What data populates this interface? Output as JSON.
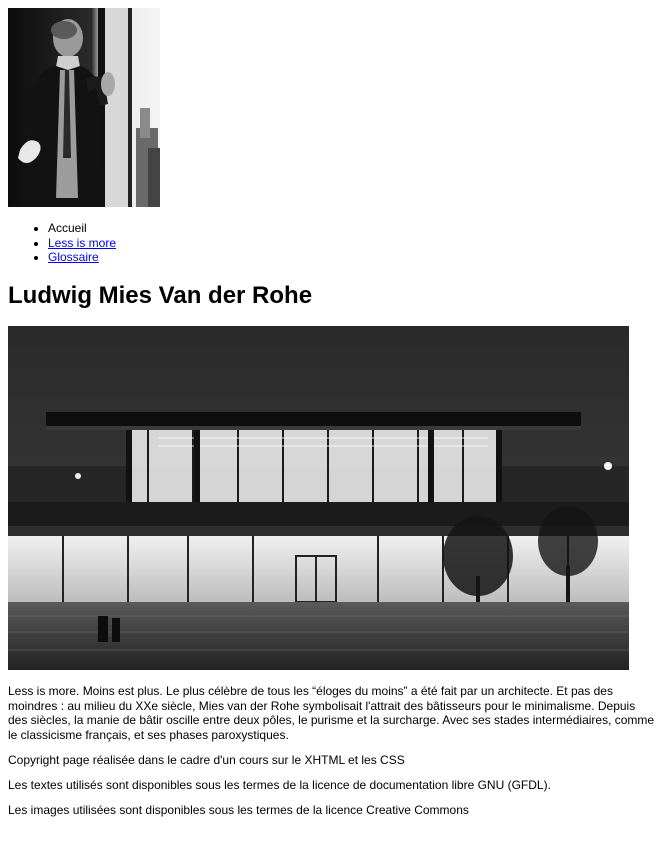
{
  "portrait": {
    "alt": "Ludwig Mies van der Rohe"
  },
  "nav": {
    "items": [
      {
        "label": "Accueil",
        "link": false
      },
      {
        "label": "Less is more",
        "link": true
      },
      {
        "label": "Glossaire",
        "link": true
      }
    ]
  },
  "page_title": "Ludwig Mies Van der Rohe",
  "building": {
    "alt": "Neue Nationalgalerie"
  },
  "content": {
    "intro": "Less is more. Moins est plus. Le plus célèbre de tous les “éloges du moins” a été fait par un architecte. Et pas des moindres : au milieu du XXe siècle, Mies van der Rohe symbolisait l'attrait des bâtisseurs pour le minimalisme. Depuis des siècles, la manie de bâtir oscille entre deux pôles, le purisme et la surcharge. Avec ses stades intermédiaires, comme le classicisme français, et ses phases paroxystiques.",
    "copyright": "Copyright page réalisée dans le cadre d'un cours sur le XHTML et les CSS",
    "gfdl": "Les textes utilisés sont disponibles sous les termes de la licence de documentation libre GNU (GFDL).",
    "cc": "Les images utilisées sont disponibles sous les termes de la licence Creative Commons"
  }
}
